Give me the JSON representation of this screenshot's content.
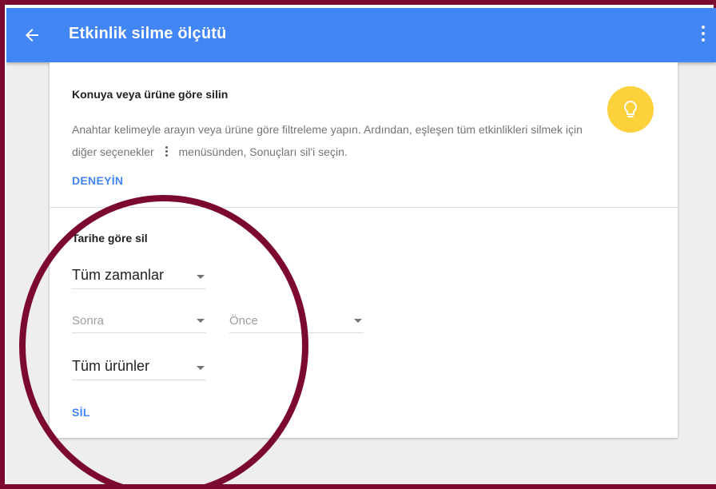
{
  "appbar": {
    "title": "Etkinlik silme ölçütü",
    "back_icon": "arrow-back-icon",
    "menu_icon": "more-vert-icon",
    "color": "#4285f4"
  },
  "topic_section": {
    "title": "Konuya veya ürüne göre silin",
    "description_part1": "Anahtar kelimeyle arayın veya ürüne göre filtreleme yapın. Ardından, eşleşen tüm etkinlikleri silmek için diğer seçenekler",
    "description_part2": "menüsünden, Sonuçları sil'i seçin.",
    "inline_icon": "more-vert-icon",
    "tip_icon": "lightbulb-icon",
    "try_label": "DENEYİN"
  },
  "date_section": {
    "title": "Tarihe göre sil",
    "range_select": "Tüm zamanlar",
    "after_placeholder": "Sonra",
    "before_placeholder": "Önce",
    "product_select": "Tüm ürünler",
    "delete_label": "SİL"
  },
  "colors": {
    "accent": "#4285f4",
    "highlight_circle": "#7b0a2e",
    "bulb": "#fcd13c"
  }
}
